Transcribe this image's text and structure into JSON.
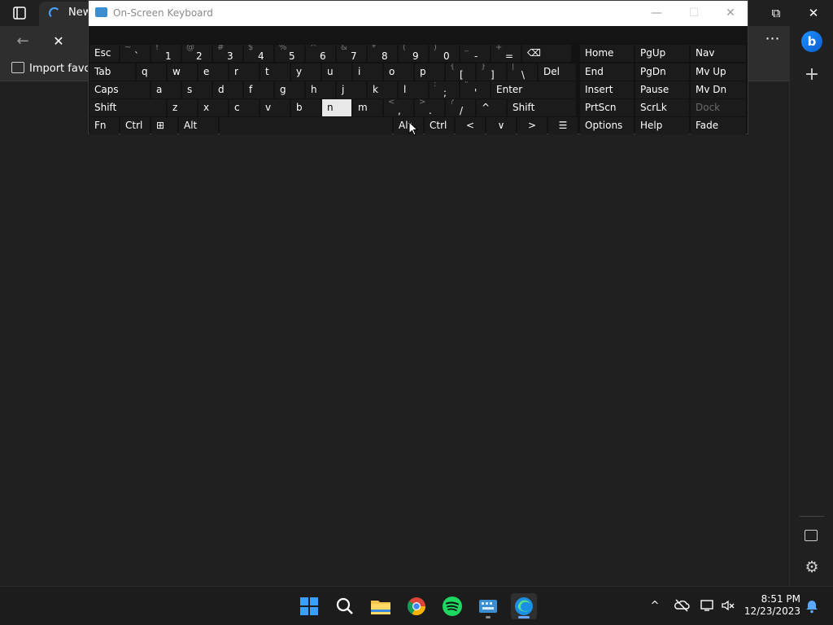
{
  "browser": {
    "active_tab_title": "New",
    "favorites_import_label": "Import favori",
    "win_restore": "⧉",
    "win_close": "✕",
    "nav_back": "←",
    "nav_stop": "✕",
    "more": "⋯",
    "sidebar_add": "+",
    "sidebar_settings": "⚙",
    "bing_label": "b",
    "icons": [
      "tab-actions-icon",
      "loading-icon",
      "back-arrow-icon",
      "stop-icon",
      "more-icon",
      "bing-icon",
      "add-icon",
      "sidebar-panel-icon",
      "settings-icon"
    ]
  },
  "osk": {
    "title": "On-Screen Keyboard",
    "minimize": "—",
    "maximize": "☐",
    "close": "✕",
    "row1": [
      {
        "main": "Esc"
      },
      {
        "shift": "~",
        "main": "`"
      },
      {
        "shift": "!",
        "main": "1"
      },
      {
        "shift": "@",
        "main": "2"
      },
      {
        "shift": "#",
        "main": "3"
      },
      {
        "shift": "$",
        "main": "4"
      },
      {
        "shift": "%",
        "main": "5"
      },
      {
        "shift": "^",
        "main": "6"
      },
      {
        "shift": "&",
        "main": "7"
      },
      {
        "shift": "*",
        "main": "8"
      },
      {
        "shift": "(",
        "main": "9"
      },
      {
        "shift": ")",
        "main": "0"
      },
      {
        "shift": "_",
        "main": "-"
      },
      {
        "shift": "+",
        "main": "="
      },
      {
        "main": "⌫"
      }
    ],
    "row2": [
      "Tab",
      "q",
      "w",
      "e",
      "r",
      "t",
      "y",
      "u",
      "i",
      "o",
      "p",
      "[",
      "]",
      "\\",
      "Del"
    ],
    "row2_shift": [
      "",
      "",
      "",
      "",
      "",
      "",
      "",
      "",
      "",
      "",
      "",
      "{",
      "}",
      "|",
      ""
    ],
    "row3": [
      "Caps",
      "a",
      "s",
      "d",
      "f",
      "g",
      "h",
      "j",
      "k",
      "l",
      ";",
      "'",
      "Enter"
    ],
    "row3_shift": [
      "",
      "",
      "",
      "",
      "",
      "",
      "",
      "",
      "",
      "",
      ":",
      "\"",
      ""
    ],
    "row4": [
      "Shift",
      "z",
      "x",
      "c",
      "v",
      "b",
      "n",
      "m",
      ",",
      ".",
      "/",
      "^",
      "Shift"
    ],
    "row4_shift": [
      "",
      "",
      "",
      "",
      "",
      "",
      "",
      "",
      "<",
      ">",
      "?",
      "",
      ""
    ],
    "row5": [
      "Fn",
      "Ctrl",
      "⊞",
      "Alt",
      "",
      "Alt",
      "Ctrl",
      "<",
      "∨",
      ">",
      "☰"
    ],
    "pressed_key": "n",
    "side_col1": [
      "Home",
      "End",
      "Insert",
      "PrtScn",
      "Options"
    ],
    "side_col2": [
      "PgUp",
      "PgDn",
      "Pause",
      "ScrLk",
      "Help"
    ],
    "side_col3": [
      "Nav",
      "Mv Up",
      "Mv Dn",
      "Dock",
      "Fade"
    ]
  },
  "taskbar": {
    "apps": [
      "start-icon",
      "search-icon",
      "file-explorer-icon",
      "chrome-icon",
      "spotify-icon",
      "onscreen-keyboard-icon",
      "edge-icon"
    ],
    "tray_chevron": "^",
    "time": "8:51 PM",
    "date": "12/23/2023"
  },
  "colors": {
    "osk_key_bg": "#1b1b1b",
    "pressed_key_bg": "#e8e8e8",
    "edge_accent": "#4aa3ff"
  }
}
